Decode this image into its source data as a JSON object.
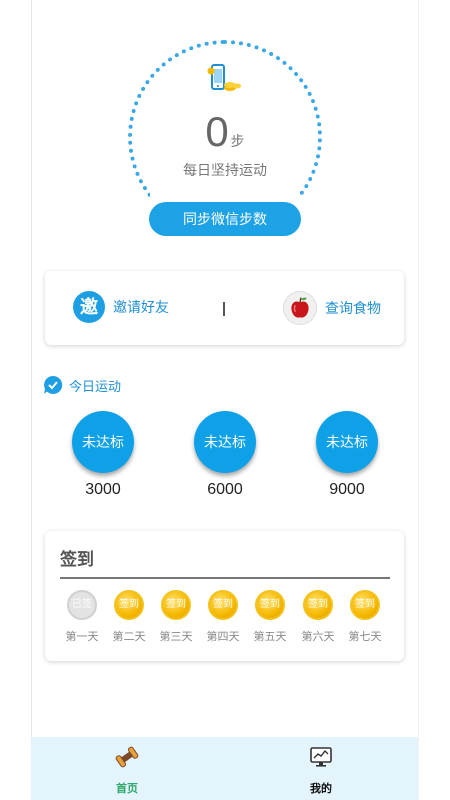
{
  "steps": {
    "count": "0",
    "unit": "步",
    "caption": "每日坚持运动",
    "sync_button": "同步微信步数"
  },
  "actions": {
    "invite_icon_text": "邀",
    "invite_label": "邀请好友",
    "food_label": "查询食物"
  },
  "today": {
    "title": "今日运动",
    "goals": [
      {
        "status": "未达标",
        "value": "3000"
      },
      {
        "status": "未达标",
        "value": "6000"
      },
      {
        "status": "未达标",
        "value": "9000"
      }
    ]
  },
  "signin": {
    "title": "签到",
    "days": [
      {
        "badge": "已签",
        "label": "第一天",
        "done": true
      },
      {
        "badge": "签到",
        "label": "第二天",
        "done": false
      },
      {
        "badge": "签到",
        "label": "第三天",
        "done": false
      },
      {
        "badge": "签到",
        "label": "第四天",
        "done": false
      },
      {
        "badge": "签到",
        "label": "第五天",
        "done": false
      },
      {
        "badge": "签到",
        "label": "第六天",
        "done": false
      },
      {
        "badge": "签到",
        "label": "第七天",
        "done": false
      }
    ]
  },
  "nav": {
    "home_label": "首页",
    "mine_label": "我的",
    "active_color": "#2fa86b"
  },
  "colors": {
    "primary": "#1ea2e6",
    "ring": "#3aa7e6",
    "coin": "#f6b800"
  },
  "icons": [
    "phone-coins-icon",
    "invite-icon",
    "apple-icon",
    "chat-check-icon",
    "dumbbell-icon",
    "monitor-chart-icon"
  ]
}
